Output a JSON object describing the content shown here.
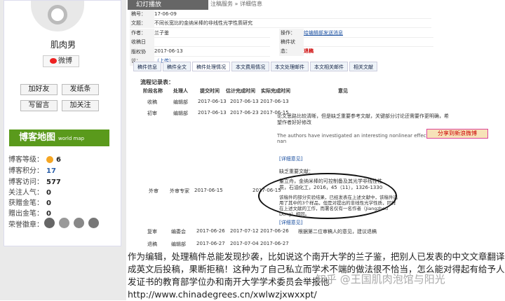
{
  "sidebar": {
    "username": "肌肉男",
    "weibo_label": "微博",
    "buttons": {
      "add_friend": "加好友",
      "send_note": "发纸条",
      "leave_msg": "写留言",
      "follow": "加关注"
    },
    "map_title": "博客地图",
    "map_sub": "world map",
    "stats": [
      {
        "label": "博客等级：",
        "value": "6"
      },
      {
        "label": "博客积分：",
        "value": "17"
      },
      {
        "label": "博客访问：",
        "value": "577"
      },
      {
        "label": "关注人气：",
        "value": "0"
      },
      {
        "label": "获赠金笔：",
        "value": "0"
      },
      {
        "label": "赠出金笔：",
        "value": "0"
      },
      {
        "label": "荣誉徽章：",
        "value": ""
      }
    ]
  },
  "screenshot": {
    "top_tab": "幻灯播放",
    "crumb": "注稿服务 » 详细信息",
    "info": {
      "id_label": "稿号：",
      "id_value": "17-06-09",
      "title_label": "文题：",
      "title_value": "不同长宽比的金纳米棒的非线性光学性质研究",
      "author_label": "作者：",
      "author_value": "兰子鉴",
      "operation_label": "操作：",
      "operation_value": "给编辑部发送消息",
      "received_label": "收稿日期：",
      "received_value": "2017-06-13",
      "status_label": "稿件状态：",
      "status_value": "退稿",
      "copyright_label": "版权协议：",
      "copyright_value": "（上传）"
    },
    "tabs": [
      "稿件信息",
      "稿件全文",
      "稿件处理情况",
      "本文费用情况",
      "本文处理邮件",
      "本文相关邮件",
      "相关文献"
    ],
    "process_title": "流程记录表：",
    "headers": [
      "阶段名称",
      "处理人",
      "提交时间",
      "估计完成时间",
      "实际完成时间",
      "意见"
    ],
    "rows": [
      {
        "stage": "收稿",
        "person": "编辑部",
        "submit": "2017-06-13",
        "est": "2017-06-13",
        "actual": "2017-06-13"
      },
      {
        "stage": "初审",
        "person": "编辑部",
        "submit": "2017-06-13",
        "est": "2017-06-23",
        "actual": "2017-06-15"
      },
      {
        "stage": "外审",
        "person": "外审专家",
        "submit": "2017-06-15",
        "est": "",
        "actual": "2017-06-15"
      },
      {
        "stage": "复审",
        "person": "编委会",
        "submit": "2017-06-26",
        "est": "2017-07-12",
        "actual": "2017-06-26"
      },
      {
        "stage": "退稿",
        "person": "编辑部",
        "submit": "2017-06-27",
        "est": "2017-07-04",
        "actual": "2017-06-27"
      }
    ],
    "review_text_1": "论文思路比较清晰，但是缺乏重要参考文献，关键部分讨论还需要作更明确，希望作者好好修改",
    "review_text_2": "The authors have investigated an interesting nonlinear effect of gold nan",
    "detail_link": "[详细意见]",
    "missing_ref": "缺乏重要文献：",
    "ref_text": "董立舟，金纳米棒的可控制备及其光学非线性性质，石油化工，2016，45（11），1326-1330",
    "copy_note": "该稿件的部分实验结果，已经发表在上述文献中，该稿件选用了其中的3个样品，但是对提出的非线性光学性质，同样在上述文献的工作，而署名仅有一名作者（Jiangzhou Dong）相同。",
    "final_note": "根据第二位审稿人的意见，建议退稿",
    "share_label": "分享到新浪微博"
  },
  "annotation": "作为编辑，处理稿件总能发现抄袭，比如说这个南开大学的兰子鉴，把别人已发表的中文文章翻译成英文后投稿，果断拒稿！这种为了自己私立而学术不端的做法很不恰当，怎么能对得起有给予人发证书的教育部学位办和南开大学学术委员会举报他http://www.chinadegrees.cn/xwlwzjxwxxpt/",
  "watermark": "知乎 @王国肌肉泡馆与阳光"
}
